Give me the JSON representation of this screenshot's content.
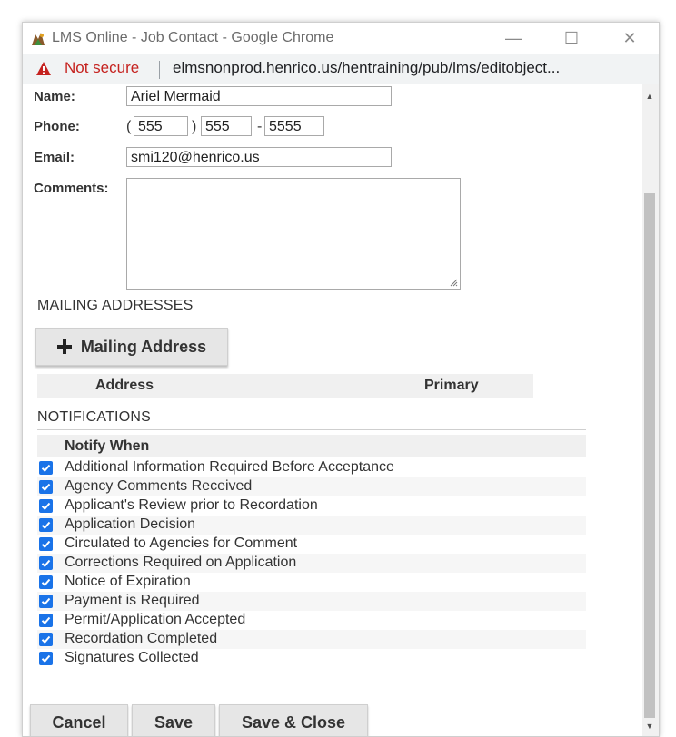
{
  "window": {
    "title": "LMS Online - Job Contact - Google Chrome",
    "minimize": "—",
    "maximize": "☐",
    "close": "✕"
  },
  "addressbar": {
    "security": "Not secure",
    "url": "elmsnonprod.henrico.us/hentraining/pub/lms/editobject..."
  },
  "form": {
    "name_label": "Name:",
    "name_value": "Ariel Mermaid",
    "phone_label": "Phone:",
    "phone_open_paren": "(",
    "phone_area": "555",
    "phone_close_paren": ")",
    "phone_prefix": "555",
    "phone_dash": "-",
    "phone_line": "5555",
    "email_label": "Email:",
    "email_value": "smi120@henrico.us",
    "comments_label": "Comments:",
    "comments_value": ""
  },
  "mailing": {
    "section_title": "MAILING ADDRESSES",
    "add_button": "Mailing Address",
    "col_address": "Address",
    "col_primary": "Primary"
  },
  "notifications": {
    "section_title": "NOTIFICATIONS",
    "header": "Notify When",
    "items": [
      {
        "label": "Additional Information Required Before Acceptance",
        "checked": true
      },
      {
        "label": "Agency Comments Received",
        "checked": true
      },
      {
        "label": "Applicant's Review prior to Recordation",
        "checked": true
      },
      {
        "label": "Application Decision",
        "checked": true
      },
      {
        "label": "Circulated to Agencies for Comment",
        "checked": true
      },
      {
        "label": "Corrections Required on Application",
        "checked": true
      },
      {
        "label": "Notice of Expiration",
        "checked": true
      },
      {
        "label": "Payment is Required",
        "checked": true
      },
      {
        "label": "Permit/Application Accepted",
        "checked": true
      },
      {
        "label": "Recordation Completed",
        "checked": true
      },
      {
        "label": "Signatures Collected",
        "checked": true
      }
    ]
  },
  "footer": {
    "cancel": "Cancel",
    "save": "Save",
    "save_close": "Save & Close"
  },
  "colors": {
    "check_accent": "#1a73e8",
    "not_secure": "#c5221f"
  }
}
